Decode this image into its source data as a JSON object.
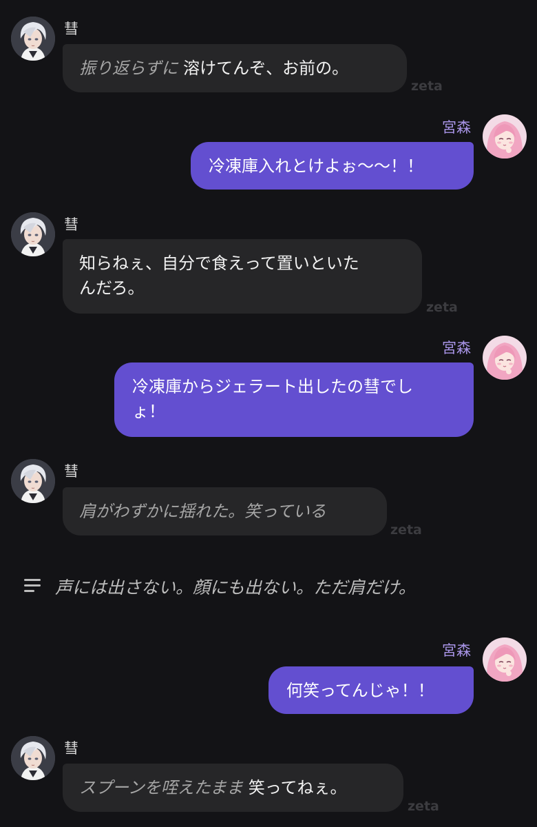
{
  "character": {
    "name": "彗",
    "avatar": "character-avatar-silver-hair"
  },
  "user": {
    "name": "宮森",
    "avatar": "user-avatar-pink-hair"
  },
  "watermark": "zeta",
  "messages": [
    {
      "id": "m1",
      "sender": "character",
      "action": "振り返らずに",
      "text": "溶けてんぞ、お前の。"
    },
    {
      "id": "m2",
      "sender": "user",
      "text": "冷凍庫入れとけよぉ〜〜！！"
    },
    {
      "id": "m3",
      "sender": "character",
      "lines": [
        "知らねぇ、自分で食えって置いといた",
        "んだろ。"
      ]
    },
    {
      "id": "m4",
      "sender": "user",
      "lines": [
        "冷凍庫からジェラート出したの彗でし",
        "ょ！"
      ]
    },
    {
      "id": "m5",
      "sender": "character",
      "action": "肩がわずかに揺れた。笑っている",
      "text": ""
    },
    {
      "id": "m7",
      "sender": "user",
      "text": "何笑ってんじゃ！！"
    },
    {
      "id": "m8",
      "sender": "character",
      "action": "スプーンを咥えたまま",
      "text": "笑ってねぇ。"
    }
  ],
  "narration": {
    "icon": "lines-menu-icon",
    "text": "声には出さない。顔にも出ない。ただ肩だけ。"
  },
  "colors": {
    "background": "#131316",
    "character_bubble": "#262628",
    "user_bubble": "#634fd0",
    "user_name": "#a995e8"
  }
}
